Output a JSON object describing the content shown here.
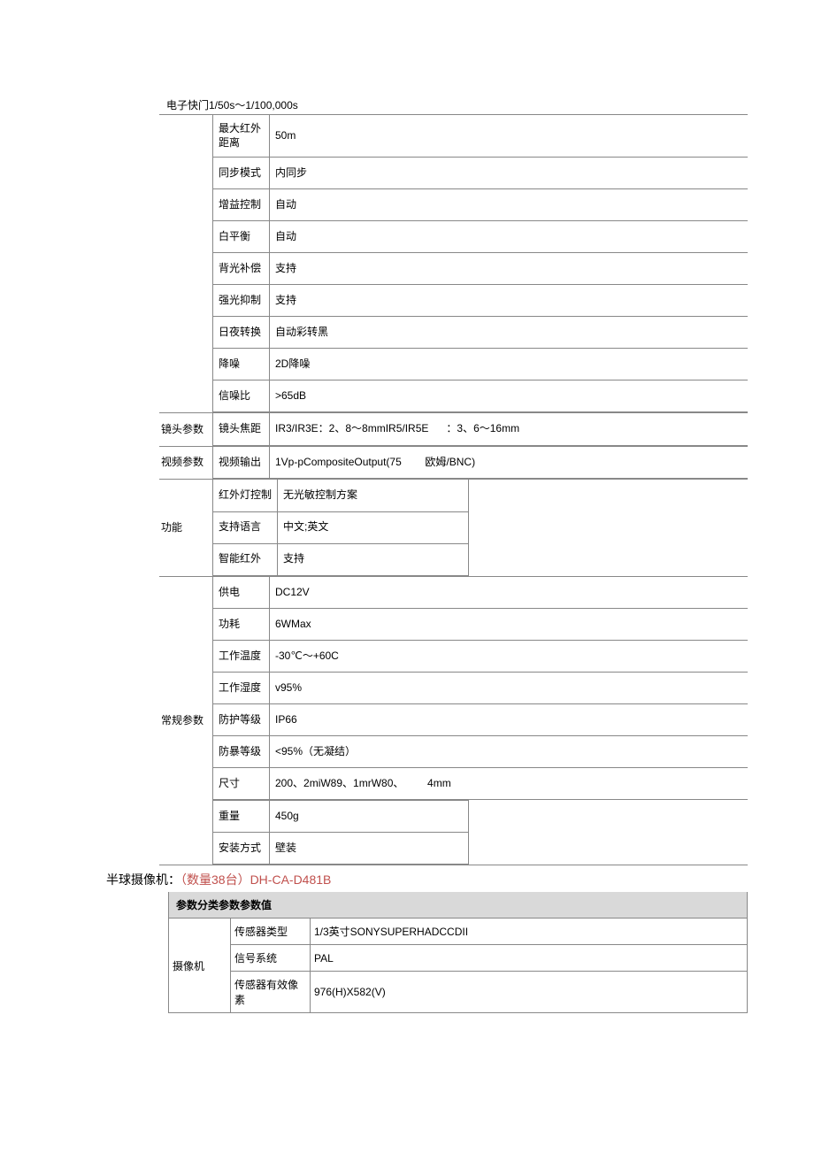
{
  "shutter_line": "电子快门1/50s～1/100,000s",
  "table1": {
    "group_camera": {
      "rows": [
        {
          "param": "最大红外距离",
          "value": "50m"
        },
        {
          "param": "同步模式",
          "value": "内同步"
        },
        {
          "param": "增益控制",
          "value": "自动"
        },
        {
          "param": "白平衡",
          "value": "自动"
        },
        {
          "param": "背光补偿",
          "value": "支持"
        },
        {
          "param": "强光抑制",
          "value": "支持"
        },
        {
          "param": "日夜转换",
          "value": "自动彩转黑"
        },
        {
          "param": "降噪",
          "value": "2D降噪"
        },
        {
          "param": "信噪比",
          "value": ">65dB"
        }
      ]
    },
    "group_lens": {
      "label": "镜头参数",
      "rows": [
        {
          "param": "镜头焦距",
          "value": "IR3/IR3E：2、8～8mmIR5/IR5E      ：3、6～16mm"
        }
      ]
    },
    "group_video": {
      "label": "视频参数",
      "rows": [
        {
          "param": "视频输出",
          "value": "1Vp-pCompositeOutput(75        欧姆/BNC)"
        }
      ]
    },
    "group_func": {
      "label": "功能",
      "rows": [
        {
          "param": "红外灯控制",
          "value": "无光敏控制方案"
        },
        {
          "param": "支持语言",
          "value": "中文;英文"
        },
        {
          "param": "智能红外",
          "value": "支持"
        }
      ]
    },
    "group_general": {
      "label": "常规参数",
      "rows": [
        {
          "param": "供电",
          "value": "DC12V"
        },
        {
          "param": "功耗",
          "value": "6WMax"
        },
        {
          "param": "工作温度",
          "value": "-30℃～+60C"
        },
        {
          "param": "工作湿度",
          "value": "v95%"
        },
        {
          "param": "防护等级",
          "value": "IP66"
        },
        {
          "param": "防暴等级",
          "value": "<95%（无凝结）"
        },
        {
          "param": "尺寸",
          "value": "200、2miW89、1mrW80、        4mm"
        },
        {
          "param": "重量",
          "value": "450g"
        },
        {
          "param": "安装方式",
          "value": "壁装"
        }
      ]
    }
  },
  "section2": {
    "title_prefix": "半球摄像机：",
    "title_suffix": "（数量38台）DH-CA-D481B",
    "header": "参数分类参数参数值",
    "group_label": "摄像机",
    "rows": [
      {
        "param": "传感器类型",
        "value": "1/3英寸SONYSUPERHADCCDII"
      },
      {
        "param": "信号系统",
        "value": "PAL"
      },
      {
        "param": "传感器有效像素",
        "value": "976(H)X582(V)"
      }
    ]
  }
}
